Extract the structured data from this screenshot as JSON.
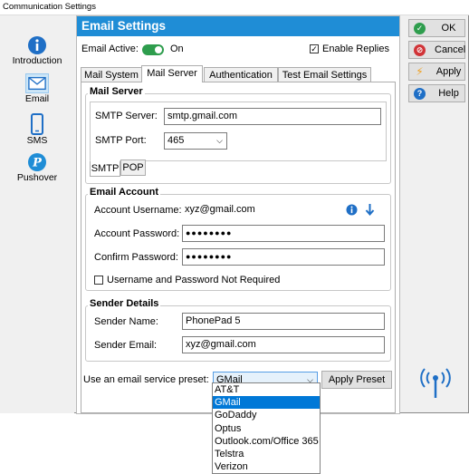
{
  "window": {
    "title": "Communication Settings"
  },
  "nav": [
    {
      "label": "Introduction",
      "icon": "info-icon"
    },
    {
      "label": "Email",
      "icon": "envelope-icon"
    },
    {
      "label": "SMS",
      "icon": "phone-icon"
    },
    {
      "label": "Pushover",
      "icon": "pushover-icon"
    }
  ],
  "panel": {
    "title": "Email Settings",
    "email_active_label": "Email Active:",
    "email_active_state": "On",
    "enable_replies_label": "Enable Replies",
    "enable_replies_checked": true
  },
  "tabs": [
    "Mail System",
    "Mail Server",
    "Authentication",
    "Test Email Settings"
  ],
  "active_tab": "Mail Server",
  "mail_server": {
    "title": "Mail Server",
    "smtp_server_label": "SMTP Server:",
    "smtp_server_value": "smtp.gmail.com",
    "smtp_port_label": "SMTP Port:",
    "smtp_port_value": "465",
    "subtabs": [
      "SMTP",
      "POP"
    ]
  },
  "email_account": {
    "title": "Email Account",
    "username_label": "Account Username:",
    "username_value": "xyz@gmail.com",
    "password_label": "Account Password:",
    "password_value": "●●●●●●●●",
    "confirm_label": "Confirm Password:",
    "confirm_value": "●●●●●●●●",
    "not_required_label": "Username and Password Not Required"
  },
  "sender": {
    "title": "Sender Details",
    "name_label": "Sender Name:",
    "name_value": "PhonePad 5",
    "email_label": "Sender Email:",
    "email_value": "xyz@gmail.com"
  },
  "preset": {
    "label": "Use an email service preset:",
    "selected": "GMail",
    "apply_label": "Apply Preset",
    "options": [
      "AT&T",
      "GMail",
      "GoDaddy",
      "Optus",
      "Outlook.com/Office 365",
      "Telstra",
      "Verizon"
    ]
  },
  "buttons": {
    "ok": "OK",
    "cancel": "Cancel",
    "apply": "Apply",
    "help": "Help"
  },
  "colors": {
    "header": "#1f8dd6",
    "toggle_on": "#2e9d4d",
    "ok_icon": "#2e9d4d",
    "cancel_icon": "#d13438",
    "help_icon": "#1f6fc6",
    "apply_icon": "#f0a020",
    "selection": "#0078d7"
  }
}
